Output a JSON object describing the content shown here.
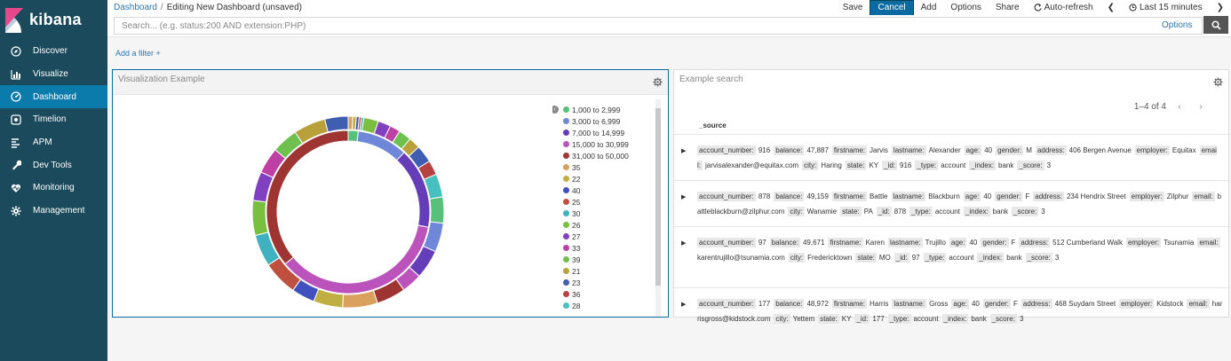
{
  "app": {
    "logo": "kibana"
  },
  "nav": [
    {
      "label": "Discover",
      "icon": "compass-icon",
      "active": false
    },
    {
      "label": "Visualize",
      "icon": "bar-chart-icon",
      "active": false
    },
    {
      "label": "Dashboard",
      "icon": "dashboard-icon",
      "active": true
    },
    {
      "label": "Timelion",
      "icon": "timelion-icon",
      "active": false
    },
    {
      "label": "APM",
      "icon": "apm-icon",
      "active": false
    },
    {
      "label": "Dev Tools",
      "icon": "wrench-icon",
      "active": false
    },
    {
      "label": "Monitoring",
      "icon": "heartbeat-icon",
      "active": false
    },
    {
      "label": "Management",
      "icon": "gear-icon",
      "active": false
    }
  ],
  "breadcrumb": {
    "root": "Dashboard",
    "sep": "/",
    "current": "Editing New Dashboard (unsaved)"
  },
  "toolbar": {
    "save": "Save",
    "cancel": "Cancel",
    "add": "Add",
    "options": "Options",
    "share": "Share",
    "auto_refresh": "Auto-refresh",
    "time": "Last 15 minutes"
  },
  "search": {
    "placeholder": "Search... (e.g. status:200 AND extension:PHP)",
    "options": "Options"
  },
  "filter": {
    "add_label": "Add a filter +"
  },
  "viz_panel": {
    "title": "Visualization Example",
    "legend": [
      {
        "label": "1,000 to 2,999",
        "color": "#57c17b"
      },
      {
        "label": "3,000 to 6,999",
        "color": "#6f87d8"
      },
      {
        "label": "7,000 to 14,999",
        "color": "#663db8"
      },
      {
        "label": "15,000 to 30,999",
        "color": "#bc52bc"
      },
      {
        "label": "31,000 to 50,000",
        "color": "#9e3533"
      },
      {
        "label": "35",
        "color": "#daa05d"
      },
      {
        "label": "22",
        "color": "#bfaf40"
      },
      {
        "label": "40",
        "color": "#4050bf"
      },
      {
        "label": "25",
        "color": "#bf5040"
      },
      {
        "label": "30",
        "color": "#40b2bf"
      },
      {
        "label": "26",
        "color": "#7bbf40"
      },
      {
        "label": "27",
        "color": "#8040bf"
      },
      {
        "label": "33",
        "color": "#bf40a4"
      },
      {
        "label": "39",
        "color": "#6ec04f"
      },
      {
        "label": "21",
        "color": "#b8a03a"
      },
      {
        "label": "23",
        "color": "#3f5eb1"
      },
      {
        "label": "36",
        "color": "#b64242"
      },
      {
        "label": "28",
        "color": "#47c0c0"
      }
    ]
  },
  "search_panel": {
    "title": "Example search",
    "pager": "1–4 of 4",
    "column": "_source",
    "rows": [
      [
        [
          "account_number:",
          "916"
        ],
        [
          "balance:",
          "47,887"
        ],
        [
          "firstname:",
          "Jarvis"
        ],
        [
          "lastname:",
          "Alexander"
        ],
        [
          "age:",
          "40"
        ],
        [
          "gender:",
          "M"
        ],
        [
          "address:",
          "406 Bergen Avenue"
        ],
        [
          "employer:",
          "Equitax"
        ],
        [
          "email:",
          "jarvisalexander@equitax.com"
        ],
        [
          "city:",
          "Haring"
        ],
        [
          "state:",
          "KY"
        ],
        [
          "_id:",
          "916"
        ],
        [
          "_type:",
          "account"
        ],
        [
          "_index:",
          "bank"
        ],
        [
          "_score:",
          "3"
        ]
      ],
      [
        [
          "account_number:",
          "878"
        ],
        [
          "balance:",
          "49,159"
        ],
        [
          "firstname:",
          "Battle"
        ],
        [
          "lastname:",
          "Blackburn"
        ],
        [
          "age:",
          "40"
        ],
        [
          "gender:",
          "F"
        ],
        [
          "address:",
          "234 Hendrix Street"
        ],
        [
          "employer:",
          "Zilphur"
        ],
        [
          "email:",
          "battleblackburn@zilphur.com"
        ],
        [
          "city:",
          "Wanamie"
        ],
        [
          "state:",
          "PA"
        ],
        [
          "_id:",
          "878"
        ],
        [
          "_type:",
          "account"
        ],
        [
          "_index:",
          "bank"
        ],
        [
          "_score:",
          "3"
        ]
      ],
      [
        [
          "account_number:",
          "97"
        ],
        [
          "balance:",
          "49,671"
        ],
        [
          "firstname:",
          "Karen"
        ],
        [
          "lastname:",
          "Trujillo"
        ],
        [
          "age:",
          "40"
        ],
        [
          "gender:",
          "F"
        ],
        [
          "address:",
          "512 Cumberland Walk"
        ],
        [
          "employer:",
          "Tsunamia"
        ],
        [
          "email:",
          "karentrujillo@tsunamia.com"
        ],
        [
          "city:",
          "Fredericktown"
        ],
        [
          "state:",
          "MO"
        ],
        [
          "_id:",
          "97"
        ],
        [
          "_type:",
          "account"
        ],
        [
          "_index:",
          "bank"
        ],
        [
          "_score:",
          "3"
        ]
      ],
      [
        [
          "account_number:",
          "177"
        ],
        [
          "balance:",
          "48,972"
        ],
        [
          "firstname:",
          "Harris"
        ],
        [
          "lastname:",
          "Gross"
        ],
        [
          "age:",
          "40"
        ],
        [
          "gender:",
          "F"
        ],
        [
          "address:",
          "468 Suydam Street"
        ],
        [
          "employer:",
          "Kidstock"
        ],
        [
          "email:",
          "harrisgross@kidstock.com"
        ],
        [
          "city:",
          "Yettem"
        ],
        [
          "state:",
          "KY"
        ],
        [
          "_id:",
          "177"
        ],
        [
          "_type:",
          "account"
        ],
        [
          "_index:",
          "bank"
        ],
        [
          "_score:",
          "3"
        ]
      ]
    ]
  }
}
